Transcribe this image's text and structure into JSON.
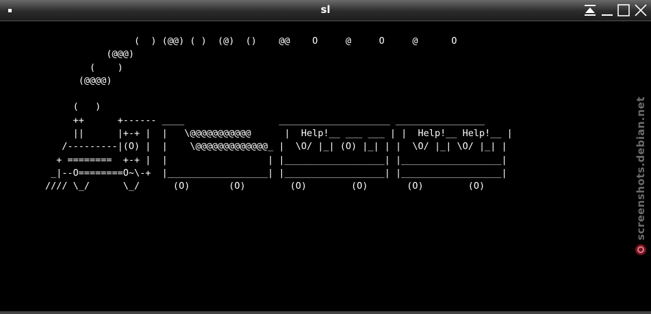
{
  "window": {
    "title": "sl"
  },
  "terminal": {
    "ascii_art": "                (  ) (@@) ( )  (@)  ()    @@    O     @     O     @      O\n           (@@@)\n        (    )\n      (@@@@)\n\n     (   )\n     ++      +------ ____                 ____________________ ________________\n     ||      |+-+ |  |   \\@@@@@@@@@@@      |  Help!__ ___ ___ | |  Help!__ Help!__ |\n   /---------|(O) |  |    \\@@@@@@@@@@@@@_ |  \\O/ |_| (O) |_| | |  \\O/ |_| \\O/ |_| |\n  + ========  +-+ |  |                  | |__________________| |__________________|\n _|--O========O~\\-+  |__________________| |__________________| |__________________|\n//// \\_/      \\_/      (O)       (O)        (O)        (O)       (O)        (O)"
  },
  "watermark": {
    "text": "screenshots.debian.net",
    "logo_icon": "debian-swirl-icon"
  },
  "icons": {
    "window_menu": "window-menu-icon",
    "maximize_vertical": "maximize-vertical-icon",
    "minimize": "minimize-icon",
    "maximize": "maximize-icon",
    "close": "close-icon"
  }
}
